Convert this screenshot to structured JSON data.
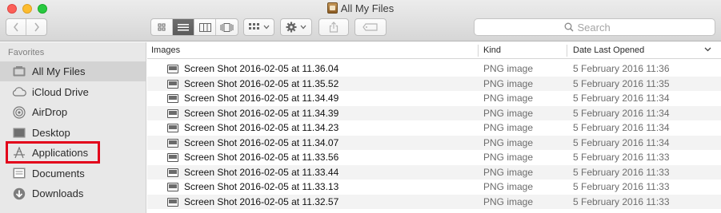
{
  "window": {
    "title": "All My Files"
  },
  "toolbar": {
    "back_label": "‹",
    "forward_label": "›",
    "view_modes": [
      "icon",
      "list",
      "column",
      "cover-flow"
    ],
    "arrange_label": "arrange",
    "action_label": "action",
    "share_label": "share",
    "tag_label": "tag",
    "search_placeholder": "Search"
  },
  "sidebar": {
    "heading": "Favorites",
    "items": [
      {
        "label": "All My Files",
        "icon": "all-my-files-icon",
        "selected": true
      },
      {
        "label": "iCloud Drive",
        "icon": "icloud-icon",
        "selected": false
      },
      {
        "label": "AirDrop",
        "icon": "airdrop-icon",
        "selected": false
      },
      {
        "label": "Desktop",
        "icon": "desktop-icon",
        "selected": false
      },
      {
        "label": "Applications",
        "icon": "applications-icon",
        "selected": false
      },
      {
        "label": "Documents",
        "icon": "documents-icon",
        "selected": false
      },
      {
        "label": "Downloads",
        "icon": "downloads-icon",
        "selected": false
      }
    ]
  },
  "file_list": {
    "columns": {
      "name": "Images",
      "kind": "Kind",
      "date": "Date Last Opened"
    },
    "rows": [
      {
        "name": "Screen Shot 2016-02-05 at 11.36.04",
        "kind": "PNG image",
        "date": "5 February 2016 11:36"
      },
      {
        "name": "Screen Shot 2016-02-05 at 11.35.52",
        "kind": "PNG image",
        "date": "5 February 2016 11:35"
      },
      {
        "name": "Screen Shot 2016-02-05 at 11.34.49",
        "kind": "PNG image",
        "date": "5 February 2016 11:34"
      },
      {
        "name": "Screen Shot 2016-02-05 at 11.34.39",
        "kind": "PNG image",
        "date": "5 February 2016 11:34"
      },
      {
        "name": "Screen Shot 2016-02-05 at 11.34.23",
        "kind": "PNG image",
        "date": "5 February 2016 11:34"
      },
      {
        "name": "Screen Shot 2016-02-05 at 11.34.07",
        "kind": "PNG image",
        "date": "5 February 2016 11:34"
      },
      {
        "name": "Screen Shot 2016-02-05 at 11.33.56",
        "kind": "PNG image",
        "date": "5 February 2016 11:33"
      },
      {
        "name": "Screen Shot 2016-02-05 at 11.33.44",
        "kind": "PNG image",
        "date": "5 February 2016 11:33"
      },
      {
        "name": "Screen Shot 2016-02-05 at 11.33.13",
        "kind": "PNG image",
        "date": "5 February 2016 11:33"
      },
      {
        "name": "Screen Shot 2016-02-05 at 11.32.57",
        "kind": "PNG image",
        "date": "5 February 2016 11:33"
      }
    ]
  },
  "colors": {
    "highlight": "#e2001a",
    "close": "#fc5f57",
    "minimize": "#fdbc2e",
    "maximize": "#28c940"
  }
}
